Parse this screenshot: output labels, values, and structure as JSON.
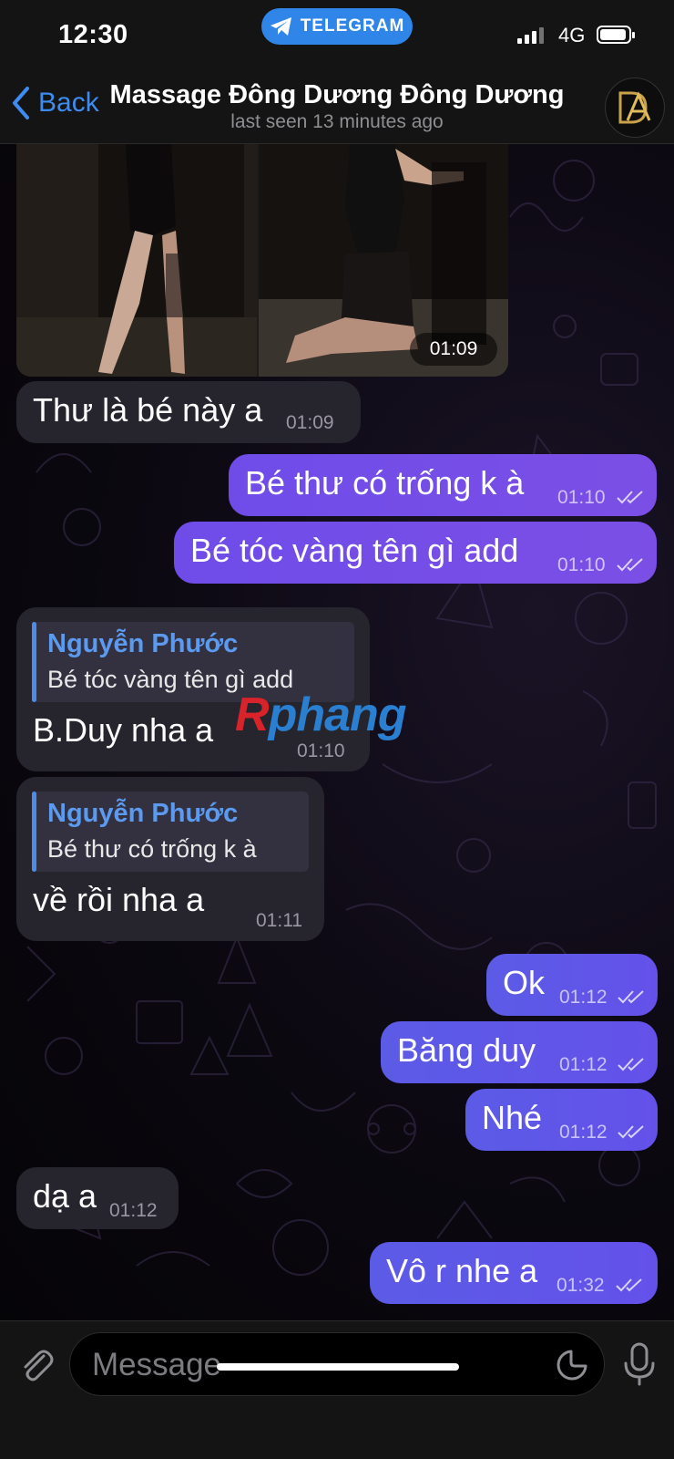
{
  "status_bar": {
    "time": "12:30",
    "app_pill": "TELEGRAM",
    "network": "4G"
  },
  "header": {
    "back_label": "Back",
    "title": "Massage Đông Dương Đông Dương",
    "subtitle": "last seen 13 minutes ago",
    "avatar_logo_letters": "DA"
  },
  "media": {
    "time": "01:09"
  },
  "messages": [
    {
      "direction": "in",
      "text": "Thư là bé này a",
      "time": "01:09"
    },
    {
      "direction": "out",
      "text": "Bé thư có trống k à",
      "time": "01:10",
      "read": true
    },
    {
      "direction": "out",
      "text": "Bé tóc vàng tên gì add",
      "time": "01:10",
      "read": true
    },
    {
      "direction": "in",
      "reply_to": {
        "name": "Nguyễn Phước",
        "text": "Bé tóc vàng tên gì add"
      },
      "text": "B.Duy nha a",
      "time": "01:10"
    },
    {
      "direction": "in",
      "reply_to": {
        "name": "Nguyễn Phước",
        "text": "Bé thư có trống k à"
      },
      "text": "về rồi nha a",
      "time": "01:11"
    },
    {
      "direction": "out",
      "text": "Ok",
      "time": "01:12",
      "read": true
    },
    {
      "direction": "out",
      "text": "Băng duy",
      "time": "01:12",
      "read": true
    },
    {
      "direction": "out",
      "text": "Nhé",
      "time": "01:12",
      "read": true
    },
    {
      "direction": "in",
      "text": "dạ a",
      "time": "01:12"
    },
    {
      "direction": "out",
      "text": "Vô r nhe a",
      "time": "01:32",
      "read": true
    }
  ],
  "watermark": {
    "first": "R",
    "rest": "phang"
  },
  "input": {
    "placeholder": "Message"
  },
  "colors": {
    "accent": "#3d8cf0",
    "outgoing_bubble": "#7050e8",
    "incoming_bubble": "#26242c",
    "reply_name": "#5b9aef"
  },
  "icons": [
    "telegram-plane-icon",
    "chevron-left-icon",
    "paperclip-icon",
    "sticker-icon",
    "microphone-icon",
    "double-check-icon"
  ]
}
